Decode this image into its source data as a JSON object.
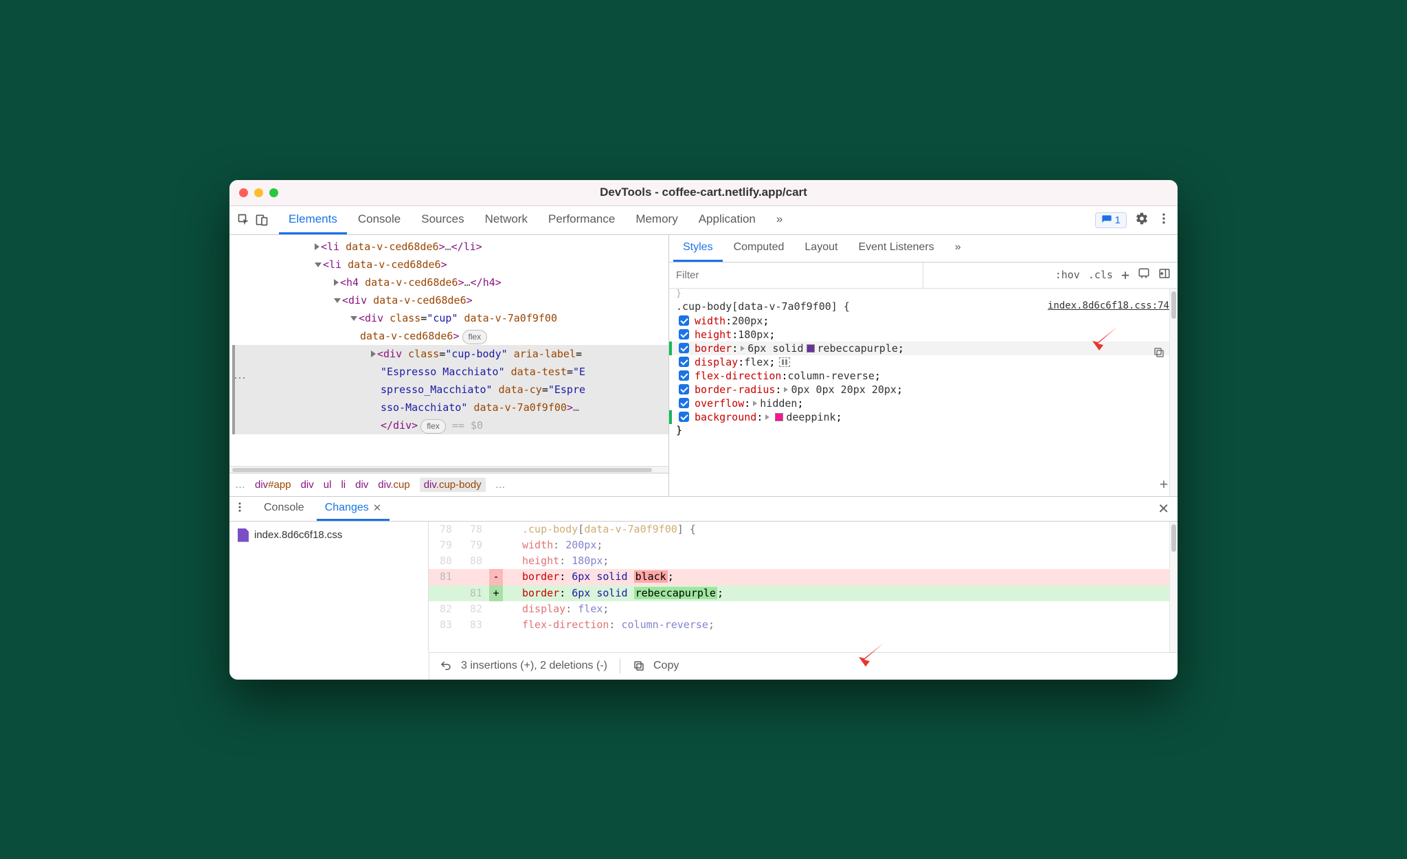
{
  "window_title": "DevTools - coffee-cart.netlify.app/cart",
  "main_tabs": [
    "Elements",
    "Console",
    "Sources",
    "Network",
    "Performance",
    "Memory",
    "Application"
  ],
  "active_main_tab": 0,
  "issues_count": "1",
  "dom": {
    "indent1_li_closed": "<li data-v-ced68de6>…</li>",
    "indent1_li_open": "<li data-v-ced68de6>",
    "h4": "<h4 data-v-ced68de6>…</h4>",
    "div_open": "<div data-v-ced68de6>",
    "cup_open_a": "<div class=\"cup\" data-v-7a0f9f00",
    "cup_open_b": "data-v-ced68de6>",
    "flex_pill": "flex",
    "sel_l1": "<div class=\"cup-body\" aria-label=",
    "sel_l2": "\"Espresso Macchiato\" data-test=\"E",
    "sel_l3": "spresso_Macchiato\" data-cy=\"Espre",
    "sel_l4": "sso-Macchiato\" data-v-7a0f9f00>…",
    "close_div": "</div>",
    "eq_zero": " == $0"
  },
  "breadcrumb": [
    "…",
    "div#app",
    "div",
    "ul",
    "li",
    "div",
    "div.cup",
    "div.cup-body",
    "…"
  ],
  "styles_tabs": [
    "Styles",
    "Computed",
    "Layout",
    "Event Listeners"
  ],
  "filter_placeholder": "Filter",
  "filter_buttons": {
    "hov": ":hov",
    "cls": ".cls"
  },
  "rule": {
    "selector": ".cup-body[data-v-7a0f9f00] {",
    "source": "index.8d6c6f18.css:74",
    "props": [
      {
        "name": "width",
        "value": "200px",
        "edited": false
      },
      {
        "name": "height",
        "value": "180px",
        "edited": false
      },
      {
        "name": "border",
        "value": "6px solid rebeccapurple",
        "expand": true,
        "swatch": "#663399",
        "edited": true,
        "hl": true
      },
      {
        "name": "display",
        "value": "flex",
        "flex": true,
        "edited": false
      },
      {
        "name": "flex-direction",
        "value": "column-reverse",
        "edited": false
      },
      {
        "name": "border-radius",
        "value": "0px 0px 20px 20px",
        "expand": true,
        "edited": false
      },
      {
        "name": "overflow",
        "value": "hidden",
        "expand": true,
        "edited": false
      },
      {
        "name": "background",
        "value": "deeppink",
        "expand": true,
        "swatch": "#ff1493",
        "edited": true
      }
    ],
    "close": "}"
  },
  "drawer_tabs": [
    "Console",
    "Changes"
  ],
  "changes_file": "index.8d6c6f18.css",
  "diff": {
    "lines": [
      {
        "o": "78",
        "n": "78",
        "code": ".cup-body[data-v-7a0f9f00] {",
        "dim": true,
        "type": "ctx",
        "kind": "sel"
      },
      {
        "o": "79",
        "n": "79",
        "code": "width: 200px;",
        "dim": true,
        "type": "ctx",
        "kind": "prop",
        "prop": "width",
        "val": "200px"
      },
      {
        "o": "80",
        "n": "80",
        "code": "height: 180px;",
        "dim": true,
        "type": "ctx",
        "kind": "prop",
        "prop": "height",
        "val": "180px"
      },
      {
        "o": "81",
        "n": "",
        "type": "del",
        "kind": "prop",
        "prop": "border",
        "val": "6px solid ",
        "hlword": "black"
      },
      {
        "o": "",
        "n": "81",
        "type": "add",
        "kind": "prop",
        "prop": "border",
        "val": "6px solid ",
        "hlword": "rebeccapurple"
      },
      {
        "o": "82",
        "n": "82",
        "code": "display: flex;",
        "dim": true,
        "type": "ctx",
        "kind": "prop",
        "prop": "display",
        "val": "flex"
      },
      {
        "o": "83",
        "n": "83",
        "code": "flex-direction: column-reverse;",
        "dim": true,
        "type": "ctx",
        "kind": "prop",
        "prop": "flex-direction",
        "val": "column-reverse"
      }
    ]
  },
  "status": {
    "changes": "3 insertions (+), 2 deletions (-)",
    "copy": "Copy"
  }
}
